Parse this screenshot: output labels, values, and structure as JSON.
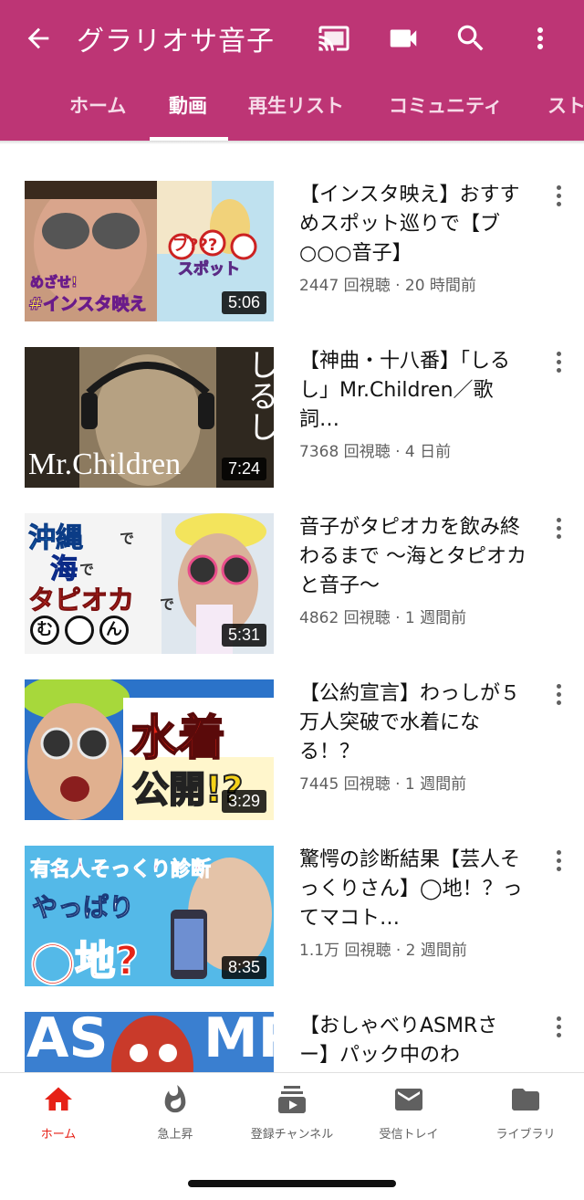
{
  "header": {
    "title": "グラリオサ音子",
    "icons": [
      "back-arrow-icon",
      "cast-icon",
      "video-camera-icon",
      "search-icon",
      "more-vert-icon"
    ],
    "colors": {
      "appbar": "#bd3575",
      "accent_active": "#e62117"
    }
  },
  "tabs": [
    {
      "label": "ホーム"
    },
    {
      "label": "動画",
      "selected": true
    },
    {
      "label": "再生リスト"
    },
    {
      "label": "コミュニティ"
    },
    {
      "label": "スト"
    }
  ],
  "videos": [
    {
      "title": "【インスタ映え】おすすめスポット巡りで【ブ○○○音子】",
      "meta": "2447 回視聴 · 20 時間前",
      "duration": "5:06",
      "thumb_text": [
        "めざせ!",
        "#インスタ映え",
        "ブ???",
        "スポット"
      ]
    },
    {
      "title": "【神曲・十八番】「しるし」Mr.Children／歌詞…",
      "meta": "7368 回視聴 · 4 日前",
      "duration": "7:24",
      "thumb_text": [
        "しるし",
        "Mr.Children"
      ]
    },
    {
      "title": "音子がタピオカを飲み終わるまで 〜海とタピオカと音子〜",
      "meta": "4862 回視聴 · 1 週間前",
      "duration": "5:31",
      "thumb_text": [
        "沖縄",
        "で",
        "海",
        "で",
        "タピオカ",
        "で",
        "む",
        "ん"
      ]
    },
    {
      "title": "【公約宣言】わっしが５万人突破で水着になる！？",
      "meta": "7445 回視聴 · 1 週間前",
      "duration": "3:29",
      "thumb_text": [
        "水着",
        "公開!?"
      ]
    },
    {
      "title": "驚愕の診断結果【芸人そっくりさん】◯地！？ってマコト…",
      "meta": "1.1万 回視聴 · 2 週間前",
      "duration": "8:35",
      "thumb_text": [
        "有名人そっくり診断",
        "やっぱり",
        "◯地?"
      ]
    },
    {
      "title": "【おしゃべりASMRさー】パック中のわ",
      "meta": "",
      "duration": "",
      "thumb_text": [
        "AS",
        "MR"
      ]
    }
  ],
  "bottom_nav": [
    {
      "label": "ホーム",
      "icon": "home-icon",
      "active": true
    },
    {
      "label": "急上昇",
      "icon": "flame-icon"
    },
    {
      "label": "登録チャンネル",
      "icon": "subscriptions-icon"
    },
    {
      "label": "受信トレイ",
      "icon": "mail-icon"
    },
    {
      "label": "ライブラリ",
      "icon": "folder-icon"
    }
  ]
}
